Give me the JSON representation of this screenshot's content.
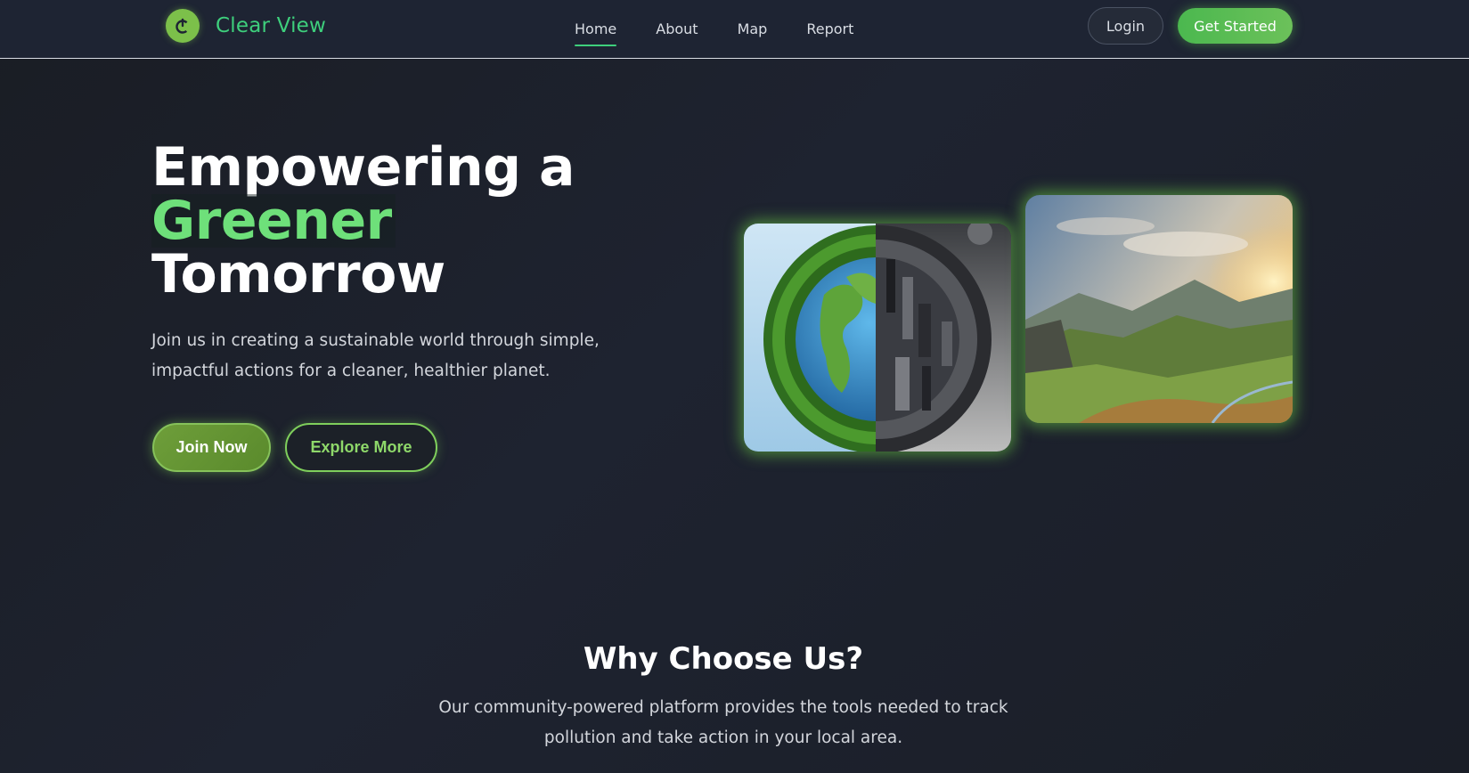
{
  "brand": {
    "name": "Clear View",
    "logo_icon": "power-icon"
  },
  "nav": {
    "links": [
      "Home",
      "About",
      "Map",
      "Report"
    ],
    "active": "Home",
    "login_label": "Login",
    "get_started_label": "Get Started"
  },
  "hero": {
    "title_line1": "Empowering a",
    "title_accent": "Greener",
    "title_line3": "Tomorrow",
    "description": "Join us in creating a sustainable world through simple, impactful actions for a cleaner, healthier planet.",
    "join_label": "Join Now",
    "explore_label": "Explore More"
  },
  "why": {
    "title": "Why Choose Us?",
    "description_line1": "Our community-powered platform provides the tools needed to track",
    "description_line2": "pollution and take action in your local area."
  },
  "colors": {
    "accent_green": "#6ee07a",
    "brand_teal": "#3ecf7c",
    "background": "#1e2330"
  }
}
